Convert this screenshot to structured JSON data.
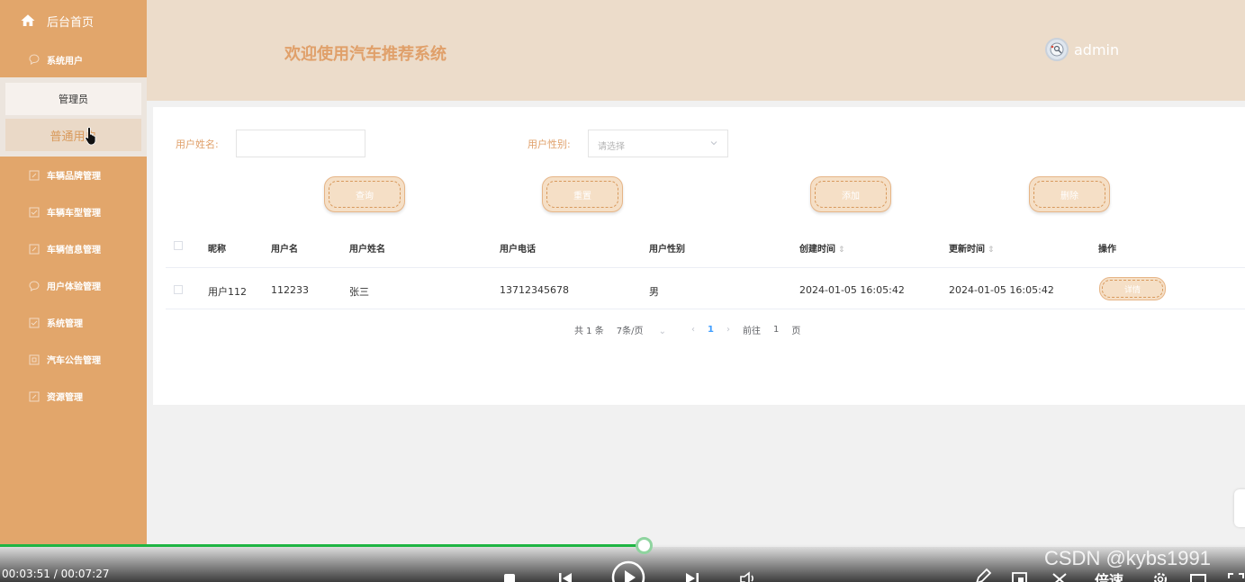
{
  "sidebar": {
    "home_label": "后台首页",
    "system_user_label": "系统用户",
    "submenu": [
      {
        "label": "管理员"
      },
      {
        "label": "普通用户"
      }
    ],
    "items": [
      {
        "label": "车辆品牌管理",
        "icon": "edit-icon"
      },
      {
        "label": "车辆车型管理",
        "icon": "check-square-icon"
      },
      {
        "label": "车辆信息管理",
        "icon": "edit-icon"
      },
      {
        "label": "用户体验管理",
        "icon": "chat-icon"
      },
      {
        "label": "系统管理",
        "icon": "check-square-icon"
      },
      {
        "label": "汽车公告管理",
        "icon": "grid-icon"
      },
      {
        "label": "资源管理",
        "icon": "edit-icon"
      }
    ]
  },
  "header": {
    "title": "欢迎使用汽车推荐系统",
    "user_name": "admin"
  },
  "search": {
    "name_label": "用户姓名:",
    "name_value": "",
    "gender_label": "用户性别:",
    "gender_placeholder": "请选择"
  },
  "buttons": {
    "query": "查询",
    "reset": "重置",
    "add": "添加",
    "delete": "删除"
  },
  "table": {
    "columns": [
      "昵称",
      "用户名",
      "用户姓名",
      "用户电话",
      "用户性别",
      "创建时间",
      "更新时间",
      "操作"
    ],
    "rows": [
      {
        "nickname": "用户112",
        "username": "112233",
        "real_name": "张三",
        "phone": "13712345678",
        "gender": "男",
        "created": "2024-01-05 16:05:42",
        "updated": "2024-01-05 16:05:42",
        "action": "详情"
      }
    ]
  },
  "pagination": {
    "total": "共 1 条",
    "page_size": "7条/页",
    "current": "1",
    "goto_prefix": "前往",
    "goto_value": "1",
    "goto_suffix": "页"
  },
  "player": {
    "time": "00:03:51 / 00:07:27",
    "progress": 0.517,
    "speed_label": "倍速",
    "watermark": "CSDN @kybs1991"
  },
  "colors": {
    "sidebar": "#e2a66b",
    "header": "#ecdcca",
    "accent": "#e0a06a",
    "progress": "#1fb543"
  }
}
